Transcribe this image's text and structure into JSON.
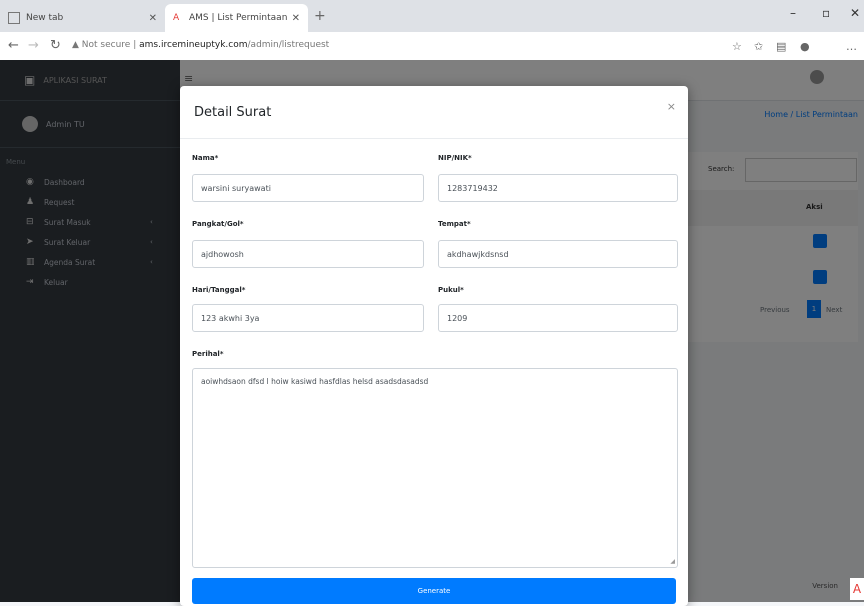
{
  "browser": {
    "tabs": [
      {
        "label": "New tab"
      },
      {
        "label": "AMS | List Permintaan"
      }
    ],
    "security_label": "Not secure",
    "url_host": "ams.ircemineuptyk.com",
    "url_path": "/admin/listrequest"
  },
  "sidebar": {
    "brand": "APLIKASI SURAT",
    "user_name": "Admin TU",
    "menu_header": "Menu",
    "items": [
      {
        "label": "Dashboard",
        "icon": "gauge-icon"
      },
      {
        "label": "Request",
        "icon": "user-icon"
      },
      {
        "label": "Surat Masuk",
        "icon": "inbox-icon"
      },
      {
        "label": "Surat Keluar",
        "icon": "send-icon"
      },
      {
        "label": "Agenda Surat",
        "icon": "book-icon"
      },
      {
        "label": "Keluar",
        "icon": "logout-icon"
      }
    ]
  },
  "background": {
    "breadcrumb": "Home / List Permintaan",
    "search_label": "Search:",
    "col_aksi": "Aksi",
    "prev": "Previous",
    "page": "1",
    "next": "Next",
    "footer": "Version"
  },
  "modal": {
    "title": "Detail Surat",
    "fields": {
      "nama": {
        "label": "Nama*",
        "value": "warsini suryawati"
      },
      "nip": {
        "label": "NIP/NIK*",
        "value": "1283719432"
      },
      "pangkat": {
        "label": "Pangkat/Gol*",
        "value": "ajdhowosh"
      },
      "tempat": {
        "label": "Tempat*",
        "value": "akdhawjkdsnsd"
      },
      "hari": {
        "label": "Hari/Tanggal*",
        "value": "123 akwhi 3ya"
      },
      "pukul": {
        "label": "Pukul*",
        "value": "1209"
      },
      "perihal": {
        "label": "Perihal*",
        "value": "aoiwhdsaon dfsd l hoiw kasiwd hasfdlas helsd asadsdasadsd"
      }
    },
    "generate_label": "Generate"
  }
}
